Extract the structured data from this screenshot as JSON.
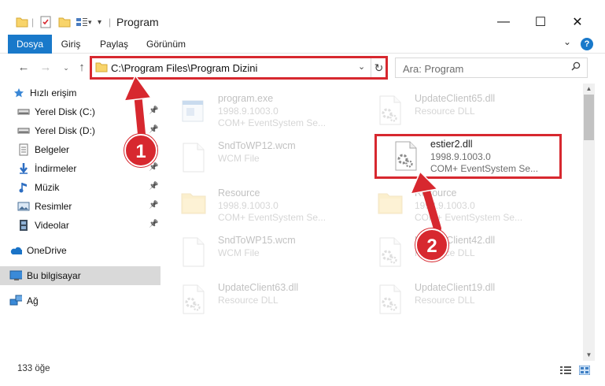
{
  "window": {
    "title": "Program",
    "minimize": "—",
    "maximize": "☐",
    "close": "✕"
  },
  "ribbon": {
    "tabs": [
      "Dosya",
      "Giriş",
      "Paylaş",
      "Görünüm"
    ],
    "help": "?"
  },
  "nav": {
    "address": "C:\\Program Files\\Program Dizini",
    "search_placeholder": "Ara: Program"
  },
  "sidebar": {
    "items": [
      {
        "label": "Hızlı erişim",
        "icon": "star-icon"
      },
      {
        "label": "Yerel Disk (C:)",
        "icon": "drive-icon",
        "pinned": true
      },
      {
        "label": "Yerel Disk (D:)",
        "icon": "drive-icon",
        "pinned": true
      },
      {
        "label": "Belgeler",
        "icon": "documents-icon",
        "pinned": true
      },
      {
        "label": "İndirmeler",
        "icon": "download-icon",
        "pinned": true
      },
      {
        "label": "Müzik",
        "icon": "music-icon",
        "pinned": true
      },
      {
        "label": "Resimler",
        "icon": "pictures-icon",
        "pinned": true
      },
      {
        "label": "Videolar",
        "icon": "video-icon",
        "pinned": true
      },
      {
        "label": "OneDrive",
        "icon": "cloud-icon"
      },
      {
        "label": "Bu bilgisayar",
        "icon": "computer-icon",
        "selected": true
      },
      {
        "label": "Ağ",
        "icon": "network-icon"
      }
    ]
  },
  "files": [
    {
      "name": "program.exe",
      "line2": "1998.9.1003.0",
      "line3": "COM+ EventSystem Se...",
      "kind": "exe"
    },
    {
      "name": "UpdateClient65.dll",
      "line2": "Resource DLL",
      "line3": "",
      "kind": "dll"
    },
    {
      "name": "SndToWP12.wcm",
      "line2": "WCM File",
      "line3": "",
      "kind": "blank"
    },
    {
      "name": "estier2.dll",
      "line2": "1998.9.1003.0",
      "line3": "COM+ EventSystem Se...",
      "kind": "dll"
    },
    {
      "name": "Resource",
      "line2": "1998.9.1003.0",
      "line3": "COM+ EventSystem Se...",
      "kind": "folder"
    },
    {
      "name": "Resource",
      "line2": "1998.9.1003.0",
      "line3": "COM+ EventSystem Se...",
      "kind": "folder"
    },
    {
      "name": "SndToWP15.wcm",
      "line2": "WCM File",
      "line3": "",
      "kind": "blank"
    },
    {
      "name": "UpdateClient42.dll",
      "line2": "Resource DLL",
      "line3": "",
      "kind": "dll"
    },
    {
      "name": "UpdateClient63.dll",
      "line2": "Resource DLL",
      "line3": "",
      "kind": "dll"
    },
    {
      "name": "UpdateClient19.dll",
      "line2": "Resource DLL",
      "line3": "",
      "kind": "dll"
    }
  ],
  "status": {
    "count": "133 öğe"
  },
  "annotations": {
    "step1": "1",
    "step2": "2",
    "color": "#d7282f"
  }
}
